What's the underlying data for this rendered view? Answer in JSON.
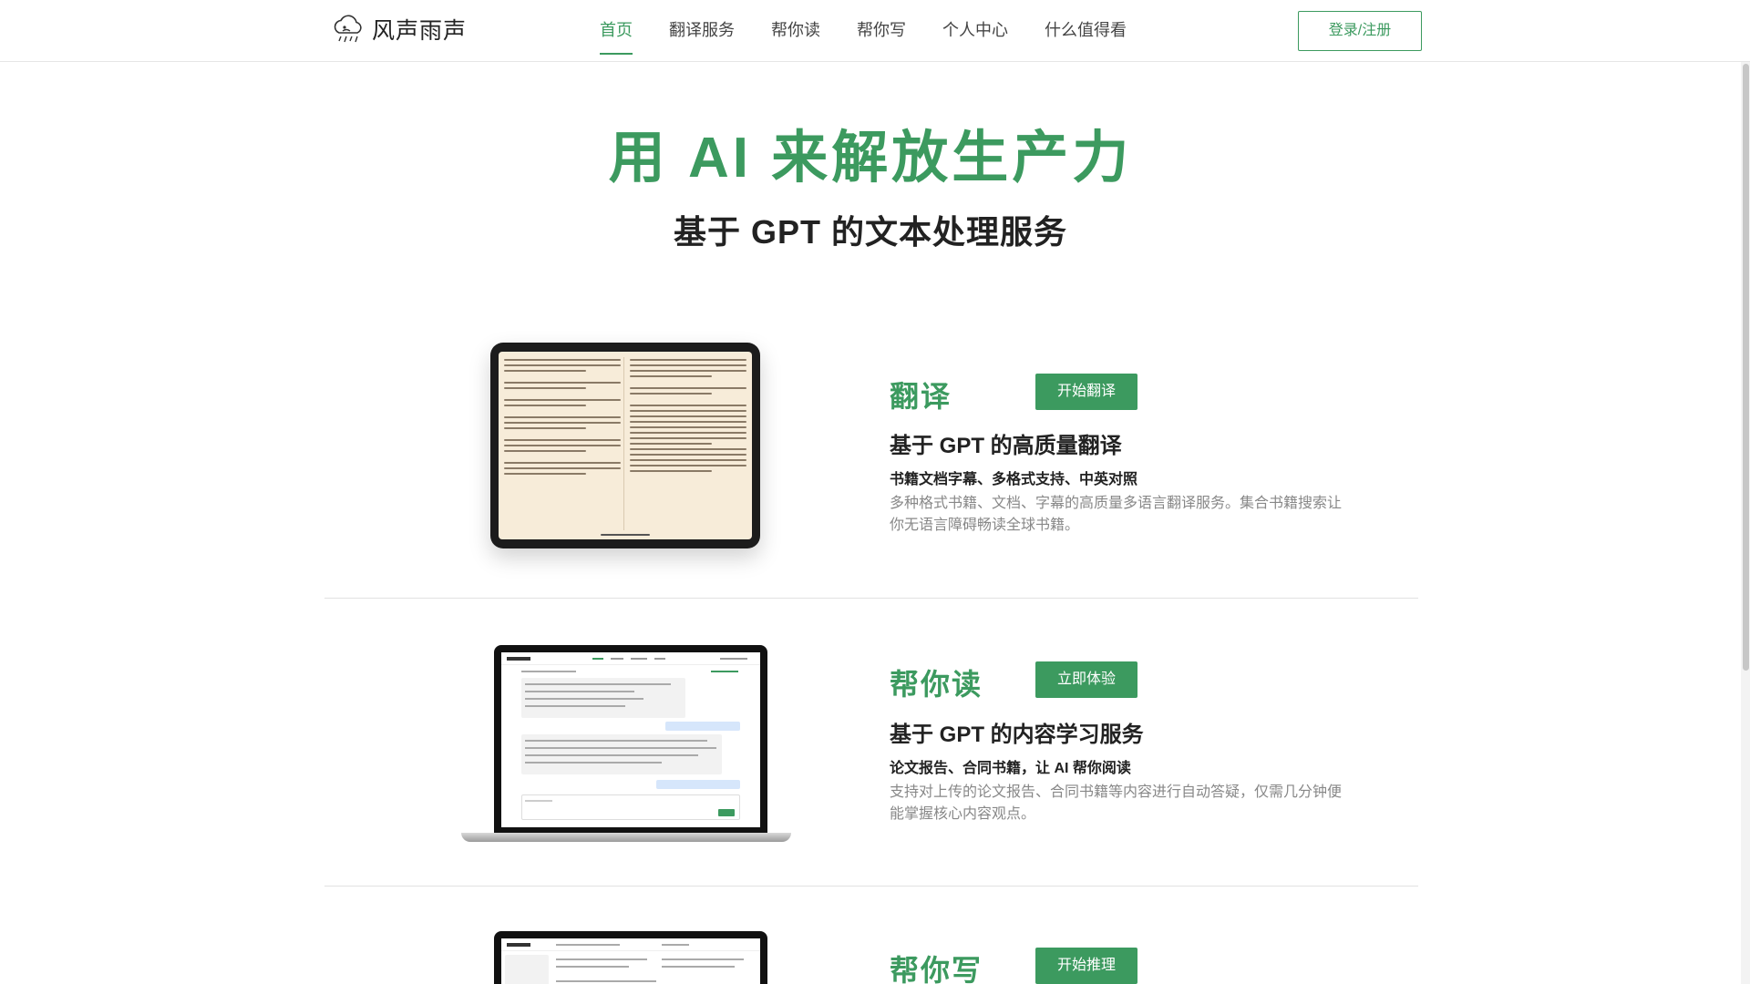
{
  "header": {
    "logo_text": "风声雨声",
    "nav": [
      "首页",
      "翻译服务",
      "帮你读",
      "帮你写",
      "个人中心",
      "什么值得看"
    ],
    "login_label": "登录/注册"
  },
  "hero": {
    "title": "用 AI 来解放生产力",
    "subtitle": "基于 GPT 的文本处理服务"
  },
  "features": [
    {
      "title": "翻译",
      "button": "开始翻译",
      "subtitle": "基于 GPT 的高质量翻译",
      "tags": "书籍文档字幕、多格式支持、中英对照",
      "description": "多种格式书籍、文档、字幕的高质量多语言翻译服务。集合书籍搜索让你无语言障碍畅读全球书籍。"
    },
    {
      "title": "帮你读",
      "button": "立即体验",
      "subtitle": "基于 GPT 的内容学习服务",
      "tags": "论文报告、合同书籍，让 AI 帮你阅读",
      "description": "支持对上传的论文报告、合同书籍等内容进行自动答疑，仅需几分钟便能掌握核心内容观点。"
    },
    {
      "title": "帮你写",
      "button": "开始推理"
    }
  ],
  "colors": {
    "accent": "#3c9a5f",
    "text": "#222222",
    "muted": "#888888",
    "divider": "#e2e2e2"
  },
  "icons": {
    "logo": "rain-cloud-icon"
  }
}
